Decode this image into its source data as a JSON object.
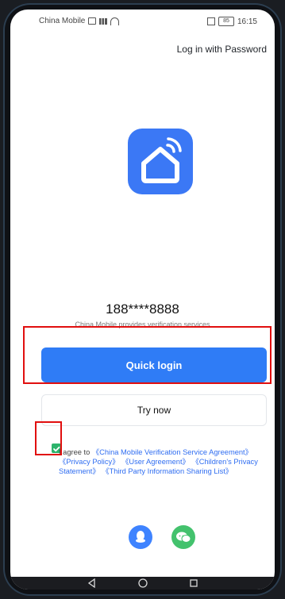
{
  "status_bar": {
    "carrier": "China Mobile",
    "time": "16:15",
    "battery": "85"
  },
  "top_link": {
    "label": "Log in with Password"
  },
  "app_logo": {
    "icon": "smart-home-logo",
    "color": "#3b78f5"
  },
  "verification": {
    "phone_number": "188****8888",
    "provider_text": "China Mobile provides verification services"
  },
  "buttons": {
    "quick_login_label": "Quick login",
    "try_now_label": "Try now"
  },
  "agreement": {
    "checked": true,
    "text_prefix": "I agree to",
    "links": [
      "《China Mobile Verification Service Agreement》",
      "《Privacy Policy》",
      "《User Agreement》",
      "《Children's Privacy Statement》",
      "《Third Party Information Sharing List》"
    ]
  },
  "social_login": {
    "items": [
      {
        "icon": "qq-icon",
        "color": "#3e83ff"
      },
      {
        "icon": "wechat-icon",
        "color": "#43c26d"
      }
    ]
  },
  "nav_bar": {
    "buttons": [
      "back-icon",
      "home-icon",
      "recent-apps-icon"
    ]
  },
  "highlights": {
    "color": "#e10f0f"
  }
}
